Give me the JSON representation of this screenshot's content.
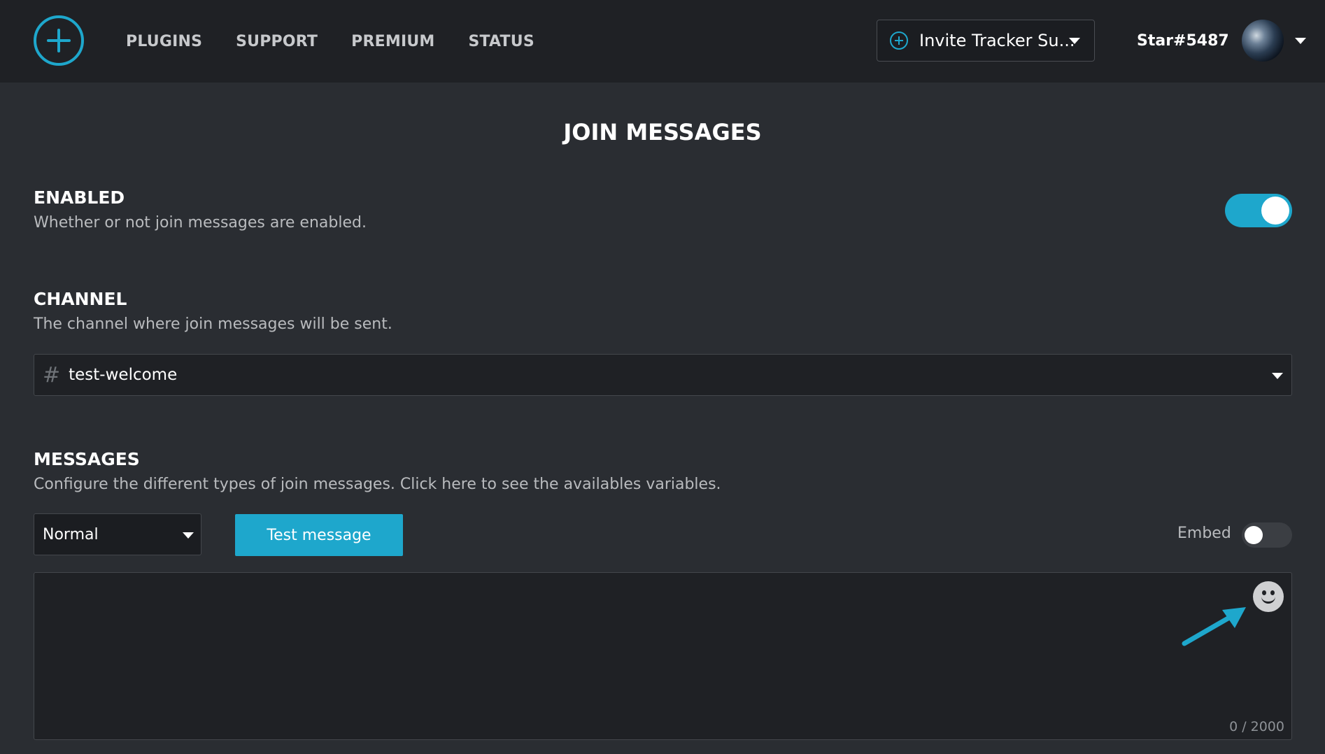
{
  "nav": {
    "logo_icon": "plus-circle-icon",
    "items": [
      "PLUGINS",
      "SUPPORT",
      "PREMIUM",
      "STATUS"
    ]
  },
  "server": {
    "name": "Invite Tracker Su...",
    "icon": "plus-circle-icon"
  },
  "user": {
    "name": "Star#5487"
  },
  "page": {
    "title": "JOIN MESSAGES"
  },
  "enabled": {
    "title": "ENABLED",
    "description": "Whether or not join messages are enabled.",
    "value": true
  },
  "channel": {
    "title": "CHANNEL",
    "description": "The channel where join messages will be sent.",
    "selected": "test-welcome",
    "prefix": "#"
  },
  "messages": {
    "title": "MESSAGES",
    "description": "Configure the different types of join messages. Click here to see the availables variables.",
    "type": "Normal",
    "test_button": "Test message",
    "embed_label": "Embed",
    "embed_enabled": false,
    "counter": "0 / 2000"
  },
  "colors": {
    "accent": "#1ea7cc",
    "background": "#2a2d32",
    "topbar": "#1f2125"
  }
}
